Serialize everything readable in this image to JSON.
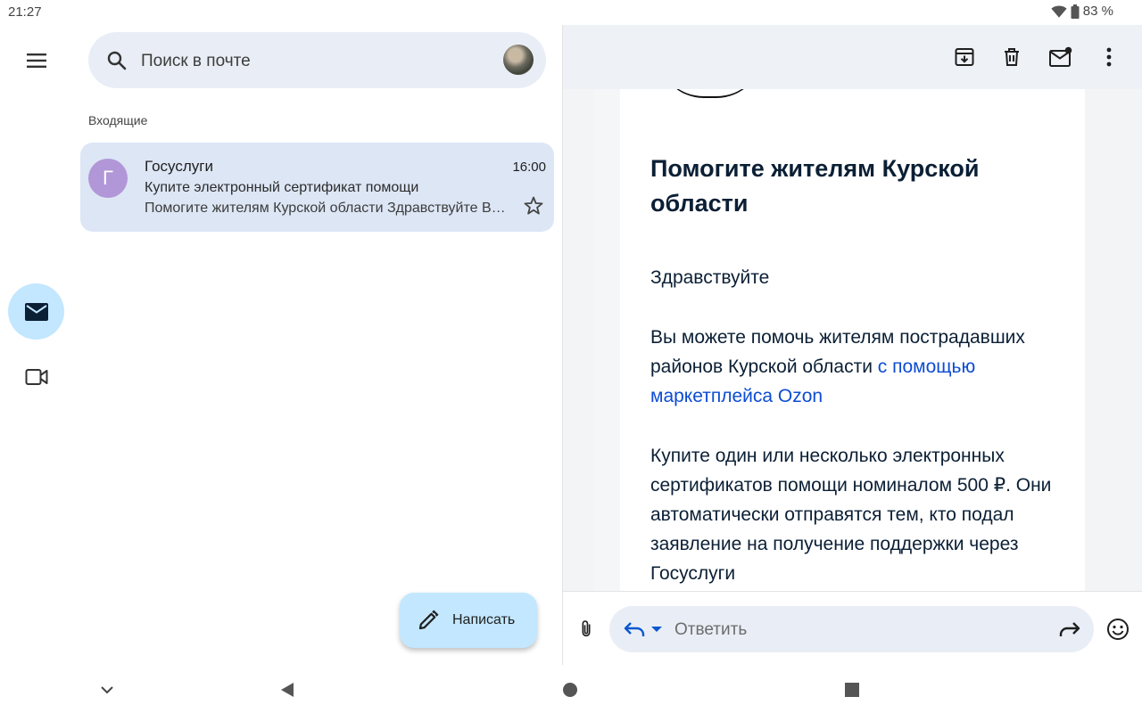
{
  "status_bar": {
    "time": "21:27",
    "battery": "83 %"
  },
  "search": {
    "placeholder": "Поиск в почте"
  },
  "inbox": {
    "section_label": "Входящие",
    "messages": [
      {
        "avatar_letter": "Г",
        "sender": "Госуслуги",
        "time": "16:00",
        "subject": "Купите электронный сертификат помощи",
        "snippet": "Помогите жителям Курской области Здравствуйте Вы можете помочь жителям пострадавших районов Курской области"
      }
    ]
  },
  "compose": {
    "label": "Написать"
  },
  "email": {
    "title": "Помогите жителям Курской области",
    "greeting": "Здравствуйте",
    "p1_text": "Вы можете помочь жителям пострадавших районов Курской области ",
    "p1_link": "с помощью маркетплейса Ozon",
    "p2": "Купите один или несколько электронных сертификатов помощи номиналом 500 ₽. Они автоматически отправятся тем, кто подал заявление на получение поддержки через Госуслуги"
  },
  "reply": {
    "placeholder": "Ответить"
  },
  "icons": {
    "menu": "menu-icon",
    "mail": "mail-icon",
    "video": "video-icon",
    "search": "search-icon",
    "star": "star-icon",
    "edit": "pencil-icon",
    "archive": "archive-icon",
    "delete": "trash-icon",
    "mark_unread": "mark-unread-icon",
    "more": "more-vert-icon",
    "attach": "attach-icon",
    "reply": "reply-icon",
    "forward": "forward-icon",
    "emoji": "emoji-icon"
  },
  "colors": {
    "accent": "#c2e7ff",
    "selected_row": "#dde6f5",
    "search_bg": "#e9eef6",
    "avatar_purple": "#b197d7",
    "link": "#0d4cd3",
    "title_text": "#0b1f35"
  }
}
